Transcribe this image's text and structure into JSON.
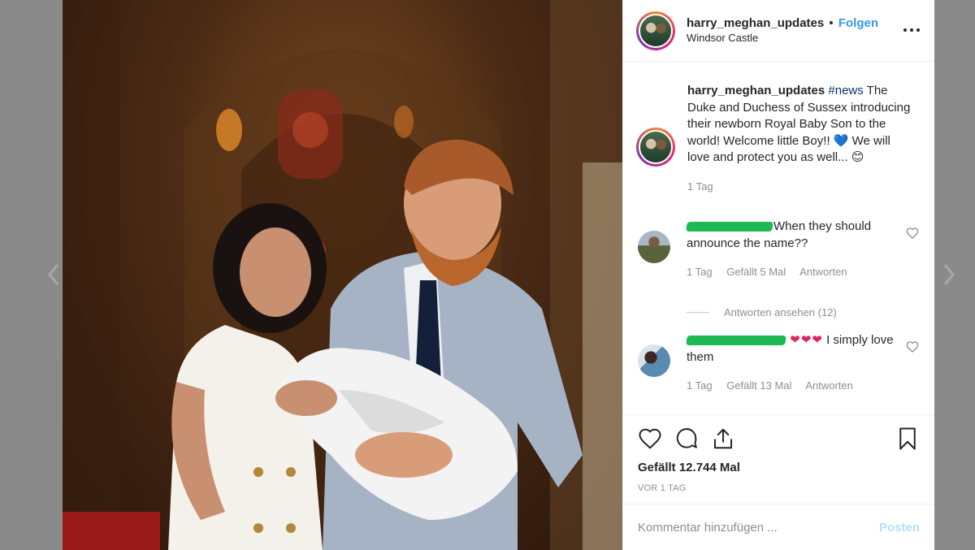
{
  "header": {
    "username": "harry_meghan_updates",
    "separator": "•",
    "follow_label": "Folgen",
    "location": "Windsor Castle"
  },
  "caption": {
    "username": "harry_meghan_updates",
    "hashtag": "#news",
    "text": "The Duke and Duchess of Sussex introducing their newborn Royal Baby Son to the world! Welcome little Boy!!",
    "emoji_heart": "💙",
    "text2": "We will love and protect you as well...",
    "emoji_smile": "😊",
    "time": "1 Tag"
  },
  "comments": [
    {
      "text": "When they should announce the name??",
      "time": "1 Tag",
      "likes": "Gefällt 5 Mal",
      "reply_label": "Antworten",
      "view_replies": "Antworten ansehen (12)"
    },
    {
      "hearts": "❤❤❤",
      "text": "I simply love them",
      "time": "1 Tag",
      "likes": "Gefällt 13 Mal",
      "reply_label": "Antworten"
    }
  ],
  "actions": {
    "likes_count": "Gefällt 12.744 Mal",
    "time_ago": "VOR 1 TAG"
  },
  "add_comment": {
    "placeholder": "Kommentar hinzufügen ...",
    "post_label": "Posten"
  },
  "icons": [
    "chevron-left-icon",
    "chevron-right-icon",
    "more-options-icon",
    "heart-icon",
    "comment-icon",
    "share-icon",
    "bookmark-icon"
  ],
  "colors": {
    "accent": "#3897f0",
    "post_disabled": "#b2dffc",
    "redaction": "#1db954"
  }
}
